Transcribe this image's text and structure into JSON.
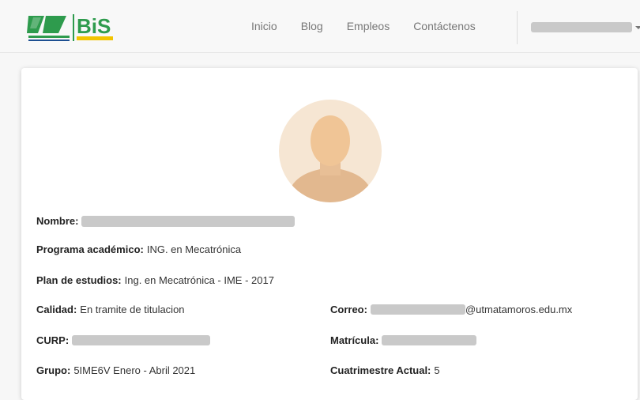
{
  "nav": {
    "logo_text": "UT BiS",
    "links": [
      "Inicio",
      "Blog",
      "Empleos",
      "Contáctenos"
    ],
    "user_name": "[redacted]"
  },
  "profile": {
    "nombre": {
      "label": "Nombre:",
      "value": "[redacted]"
    },
    "programa": {
      "label": "Programa académico:",
      "value": "ING. en Mecatrónica"
    },
    "plan": {
      "label": "Plan de estudios:",
      "value": "Ing. en Mecatrónica - IME - 2017"
    },
    "calidad": {
      "label": "Calidad:",
      "value": "En tramite de titulacion"
    },
    "correo": {
      "label": "Correo:",
      "value": "@utmatamoros.edu.mx"
    },
    "curp": {
      "label": "CURP:",
      "value": "[redacted]"
    },
    "matricula": {
      "label": "Matrícula:",
      "value": "[redacted]"
    },
    "grupo": {
      "label": "Grupo:",
      "value": "5IME6V Enero - Abril 2021"
    },
    "cuatrimestre": {
      "label": "Cuatrimestre Actual:",
      "value": "5"
    }
  },
  "colors": {
    "brand_green": "#2e9b4d",
    "brand_blue": "#1d4f91",
    "redaction_gray": "#c9c9c9"
  }
}
